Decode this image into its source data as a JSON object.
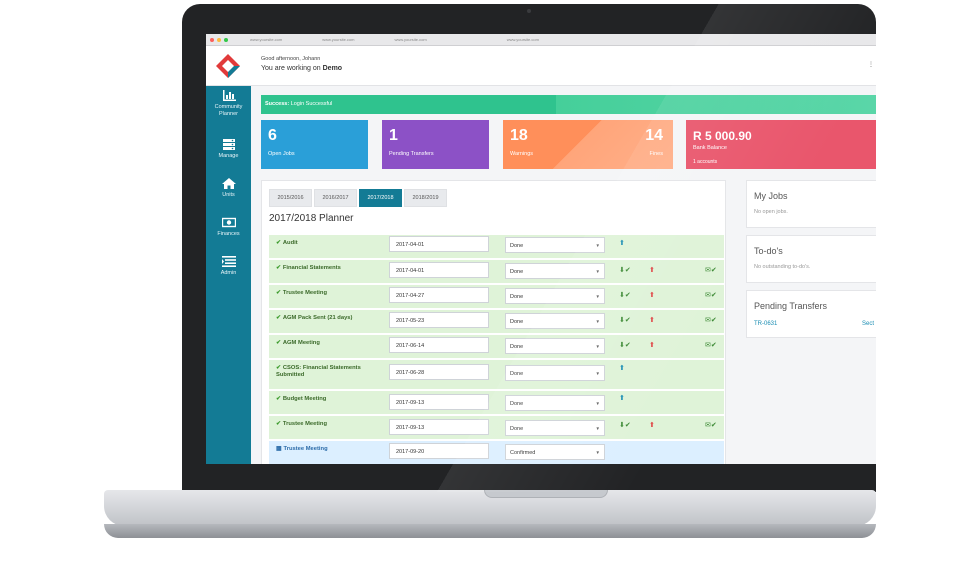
{
  "browser": {
    "tabs": [
      "www.yoursite.com",
      "www.yoursite.com",
      "www.yoursite.com"
    ],
    "address": "www.yoursite.com"
  },
  "header": {
    "greeting": "Good afternoon, Johann",
    "working_prefix": "You are working on",
    "working_name": "Demo",
    "menu": "⋮"
  },
  "sidebar": {
    "items": [
      {
        "label": "Community Planner",
        "icon": "bar-chart-icon"
      },
      {
        "label": "Manage",
        "icon": "list-icon"
      },
      {
        "label": "Units",
        "icon": "home-icon"
      },
      {
        "label": "Finances",
        "icon": "money-icon"
      },
      {
        "label": "Admin",
        "icon": "list-lines-icon"
      }
    ]
  },
  "alert": {
    "title": "Success:",
    "text": "Login Successful"
  },
  "stats": [
    {
      "value": "6",
      "label": "Open Jobs",
      "color": "#2a9fd8"
    },
    {
      "value": "1",
      "label": "Pending Transfers",
      "color": "#8c51c6"
    },
    {
      "value": "18",
      "label": "Warnings",
      "value2": "14",
      "label2": "Fines",
      "color": "#ff8f5a"
    },
    {
      "value": "R 5 000.90",
      "label": "Bank Balance",
      "sub": "1 accounts",
      "color": "#e9566c"
    }
  ],
  "planner": {
    "tabs": [
      "2015/2016",
      "2016/2017",
      "2017/2018",
      "2018/2019"
    ],
    "active_tab": "2017/2018",
    "title": "2017/2018 Planner",
    "rows": [
      {
        "name": "Audit",
        "date": "2017-04-01",
        "status": "Done"
      },
      {
        "name": "Financial Statements",
        "date": "2017-04-01",
        "status": "Done"
      },
      {
        "name": "Trustee Meeting",
        "date": "2017-04-27",
        "status": "Done"
      },
      {
        "name": "AGM Pack Sent (21 days)",
        "date": "2017-05-23",
        "status": "Done"
      },
      {
        "name": "AGM Meeting",
        "date": "2017-06-14",
        "status": "Done"
      },
      {
        "name": "CSOS: Financial Statements Submitted",
        "date": "2017-06-28",
        "status": "Done"
      },
      {
        "name": "Budget Meeting",
        "date": "2017-09-13",
        "status": "Done"
      },
      {
        "name": "Trustee Meeting",
        "date": "2017-09-13",
        "status": "Done"
      },
      {
        "name": "Trustee Meeting",
        "date": "2017-09-20",
        "status": "Confirmed"
      }
    ]
  },
  "my_jobs": {
    "title": "My Jobs",
    "empty": "No open jobs."
  },
  "todos": {
    "title": "To-do's",
    "empty": "No outstanding to-do's."
  },
  "pending_transfers": {
    "title": "Pending Transfers",
    "item": "TR-0631",
    "action": "Sect"
  }
}
